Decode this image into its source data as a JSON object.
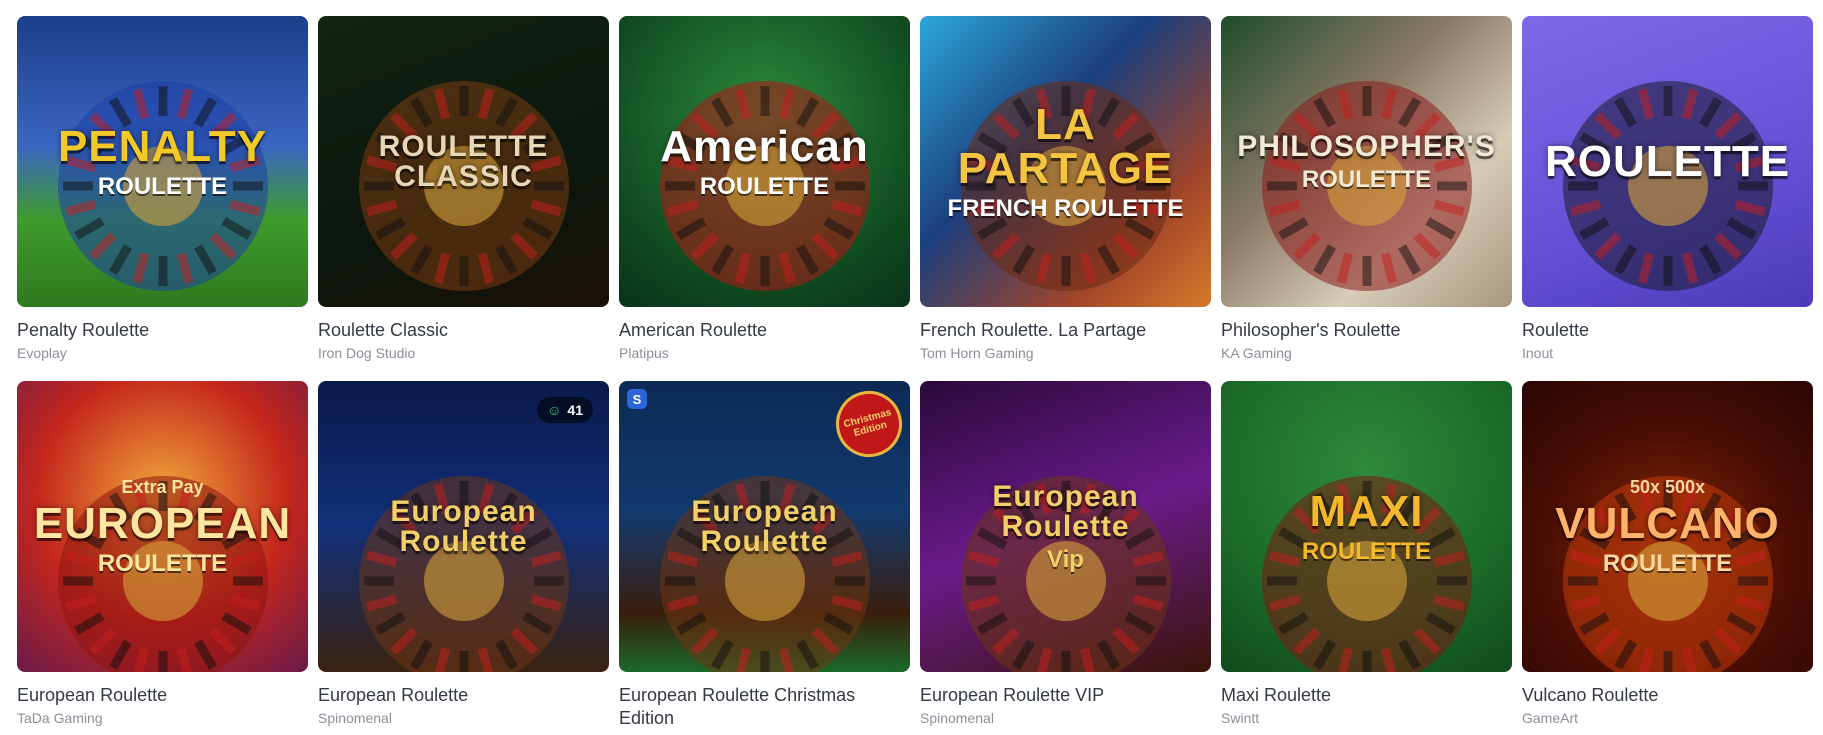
{
  "games": [
    {
      "title": "Penalty Roulette",
      "provider": "Evoplay",
      "art": {
        "main": "PENALTY",
        "sub": "ROULETTE",
        "tag": ""
      },
      "bg": "linear-gradient(180deg,#1b3f8a 0%,#3b67c2 45%,#3f9b2c 70%,#2f7a1f 100%)",
      "fg": "#f3c928",
      "sub_fg": "#ffffff",
      "wheel": "#1e3fa8"
    },
    {
      "title": "Roulette Classic",
      "provider": "Iron Dog Studio",
      "art": {
        "main": "ROULETTE CLASSIC",
        "sub": "",
        "tag": ""
      },
      "bg": "linear-gradient(160deg,#122315 0%,#0b170d 60%,#1a1008 100%)",
      "fg": "#e7d7b6",
      "sub_fg": "#e7d7b6",
      "wheel": "#7a3d12"
    },
    {
      "title": "American Roulette",
      "provider": "Platipus",
      "art": {
        "main": "American",
        "sub": "ROULETTE",
        "tag": ""
      },
      "bg": "radial-gradient(circle at 50% 35%,#2e8a3f 0%,#0f4a1f 70%,#09331a 100%)",
      "fg": "#ffffff",
      "sub_fg": "#ffffff",
      "wheel": "#b01515"
    },
    {
      "title": "French Roulette. La Partage",
      "provider": "Tom Horn Gaming",
      "art": {
        "main": "LA PARTAGE",
        "sub": "FRENCH ROULETTE",
        "tag": ""
      },
      "bg": "linear-gradient(135deg,#2ba7d9 0%,#1c3f7e 40%,#a0452a 75%,#d47a2a 100%)",
      "fg": "#f5c542",
      "sub_fg": "#ffffff",
      "wheel": "#6b2a12"
    },
    {
      "title": "Philosopher's Roulette",
      "provider": "KA Gaming",
      "art": {
        "main": "PHILOSOPHER'S",
        "sub": "ROULETTE",
        "tag": ""
      },
      "bg": "linear-gradient(135deg,#1f4d2a 0%,#8b7a66 40%,#d8ccb6 70%,#a89680 100%)",
      "fg": "#f3ead6",
      "sub_fg": "#f3ead6",
      "wheel": "#8c1c1c"
    },
    {
      "title": "Roulette",
      "provider": "Inout",
      "art": {
        "main": "ROULETTE",
        "sub": "",
        "tag": ""
      },
      "bg": "linear-gradient(160deg,#7c6ae8 0%,#6551d6 60%,#4b3bb8 100%)",
      "fg": "#ffffff",
      "sub_fg": "#ffffff",
      "wheel": "#1a1a2c"
    },
    {
      "title": "European Roulette",
      "provider": "TaDa Gaming",
      "art": {
        "main": "EUROPEAN",
        "sub": "ROULETTE",
        "tag": "Extra Pay"
      },
      "bg": "radial-gradient(circle at 50% 40%,#f2a83a 0%,#c4271c 55%,#6a1a4a 100%)",
      "fg": "#ffe6a0",
      "sub_fg": "#ffe6a0",
      "wheel": "#8e1410"
    },
    {
      "title": "European Roulette",
      "provider": "Spinomenal",
      "art": {
        "main": "European Roulette",
        "sub": "",
        "tag": ""
      },
      "bg": "linear-gradient(180deg,#0a1a4a 0%,#12307a 50%,#3a2210 100%)",
      "fg": "#f3cf6a",
      "sub_fg": "#f3cf6a",
      "wheel": "#6e3514",
      "badge": "41"
    },
    {
      "title": "European Roulette Christmas Edition",
      "provider": "",
      "art": {
        "main": "European Roulette",
        "sub": "",
        "tag": ""
      },
      "bg": "linear-gradient(180deg,#0d2a55 0%,#123a6e 45%,#3a1e0c 80%,#1a6a2a 100%)",
      "fg": "#f3cf6a",
      "sub_fg": "#f3cf6a",
      "wheel": "#6e3514",
      "corner": "S",
      "ribbon": "Christmas Edition"
    },
    {
      "title": "European Roulette VIP",
      "provider": "Spinomenal",
      "art": {
        "main": "European Roulette",
        "sub": "Vip",
        "tag": ""
      },
      "bg": "linear-gradient(160deg,#2a0a3a 0%,#6a1a8a 50%,#3a1408 100%)",
      "fg": "#f3cf6a",
      "sub_fg": "#f3cf6a",
      "wheel": "#6e3514"
    },
    {
      "title": "Maxi Roulette",
      "provider": "Swintt",
      "art": {
        "main": "MAXI",
        "sub": "ROULETTE",
        "tag": ""
      },
      "bg": "radial-gradient(circle at 50% 30%,#2f8a3a 0%,#1c6a2a 60%,#0f4a1c 100%)",
      "fg": "#f5b82a",
      "sub_fg": "#f5b82a",
      "wheel": "#7a1a10"
    },
    {
      "title": "Vulcano Roulette",
      "provider": "GameArt",
      "art": {
        "main": "VULCANO",
        "sub": "ROULETTE",
        "tag": "50x 500x"
      },
      "bg": "radial-gradient(circle at 50% 60%,#8a2a0a 0%,#4a0e04 55%,#2a0602 100%)",
      "fg": "#ffb36a",
      "sub_fg": "#ffd7a0",
      "wheel": "#c43a0a"
    }
  ],
  "icons": {
    "players": "people-icon"
  }
}
